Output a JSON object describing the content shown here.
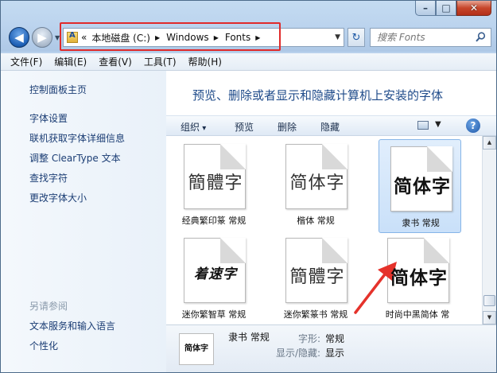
{
  "window": {
    "caption": {
      "minimize": "–",
      "maximize": "□",
      "close": "✕"
    }
  },
  "nav": {
    "back_icon": "◀",
    "forward_icon": "▶",
    "breadcrumbs": [
      "«",
      "本地磁盘 (C:)",
      "Windows",
      "Fonts"
    ],
    "search_placeholder": "搜索 Fonts",
    "refresh_icon": "↻"
  },
  "menubar": {
    "items": [
      "文件(F)",
      "编辑(E)",
      "查看(V)",
      "工具(T)",
      "帮助(H)"
    ]
  },
  "left_pane": {
    "tasks": [
      "控制面板主页",
      "字体设置",
      "联机获取字体详细信息",
      "调整 ClearType 文本",
      "查找字符",
      "更改字体大小"
    ],
    "see_also_title": "另请参阅",
    "see_also": [
      "文本服务和输入语言",
      "个性化"
    ]
  },
  "main": {
    "heading": "预览、删除或者显示和隐藏计算机上安装的字体",
    "commands": {
      "organize": "组织",
      "preview": "预览",
      "delete": "删除",
      "hide": "隐藏",
      "help": "?"
    },
    "fonts": [
      {
        "preview": "簡體字",
        "label": "经典繁印篆 常规"
      },
      {
        "preview": "简体字",
        "label": "楷体 常规"
      },
      {
        "preview": "简体字",
        "label": "隶书 常规"
      },
      {
        "preview": "着速字",
        "label": "迷你繁智草 常规"
      },
      {
        "preview": "簡體字",
        "label": "迷你繁篆书 常规"
      },
      {
        "preview": "简体字",
        "label": "时尚中黑简体 常"
      }
    ],
    "selected_index": 2
  },
  "details": {
    "thumb": "简体字",
    "name": "隶书 常规",
    "style_label": "字形:",
    "style_value": "常规",
    "visibility_label": "显示/隐藏:",
    "visibility_value": "显示"
  }
}
